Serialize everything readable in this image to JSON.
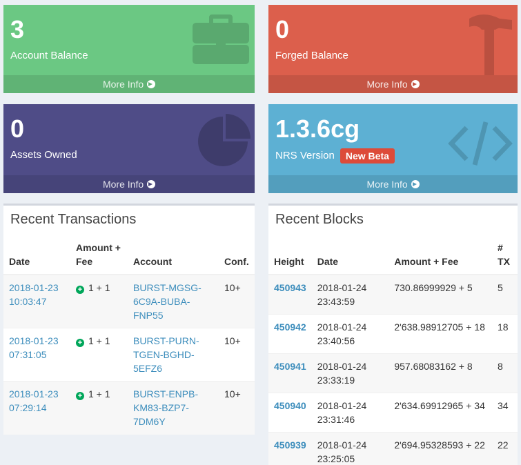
{
  "boxes": {
    "account": {
      "value": "3",
      "label": "Account Balance",
      "footer": "More Info",
      "icon": "briefcase-icon",
      "color": "#6bc883"
    },
    "forged": {
      "value": "0",
      "label": "Forged Balance",
      "footer": "More Info",
      "icon": "hammer-icon",
      "color": "#dc5f4c"
    },
    "assets": {
      "value": "0",
      "label": "Assets Owned",
      "footer": "More Info",
      "icon": "pie-chart-icon",
      "color": "#4f4c87"
    },
    "nrs": {
      "value": "1.3.6cg",
      "label": "NRS Version",
      "badge": "New Beta",
      "footer": "More Info",
      "icon": "code-icon",
      "color": "#5db0d3"
    }
  },
  "transactions": {
    "title": "Recent Transactions",
    "headers": [
      "Date",
      "Amount + Fee",
      "Account",
      "Conf."
    ],
    "rows": [
      {
        "date": "2018-01-23 10:03:47",
        "amount": "1 + 1",
        "account": "BURST-MGSG-6C9A-BUBA-FNP55",
        "conf": "10+"
      },
      {
        "date": "2018-01-23 07:31:05",
        "amount": "1 + 1",
        "account": "BURST-PURN-TGEN-BGHD-5EFZ6",
        "conf": "10+"
      },
      {
        "date": "2018-01-23 07:29:14",
        "amount": "1 + 1",
        "account": "BURST-ENPB-KM83-BZP7-7DM6Y",
        "conf": "10+"
      }
    ]
  },
  "blocks": {
    "title": "Recent Blocks",
    "headers": [
      "Height",
      "Date",
      "Amount + Fee",
      "# TX"
    ],
    "rows": [
      {
        "height": "450943",
        "date": "2018-01-24 23:43:59",
        "amount": "730.86999929 + 5",
        "tx": "5"
      },
      {
        "height": "450942",
        "date": "2018-01-24 23:40:56",
        "amount": "2'638.98912705 + 18",
        "tx": "18"
      },
      {
        "height": "450941",
        "date": "2018-01-24 23:33:19",
        "amount": "957.68083162 + 8",
        "tx": "8"
      },
      {
        "height": "450940",
        "date": "2018-01-24 23:31:46",
        "amount": "2'634.69912965 + 34",
        "tx": "34"
      },
      {
        "height": "450939",
        "date": "2018-01-24 23:25:05",
        "amount": "2'694.95328593 + 22",
        "tx": "22"
      }
    ]
  }
}
